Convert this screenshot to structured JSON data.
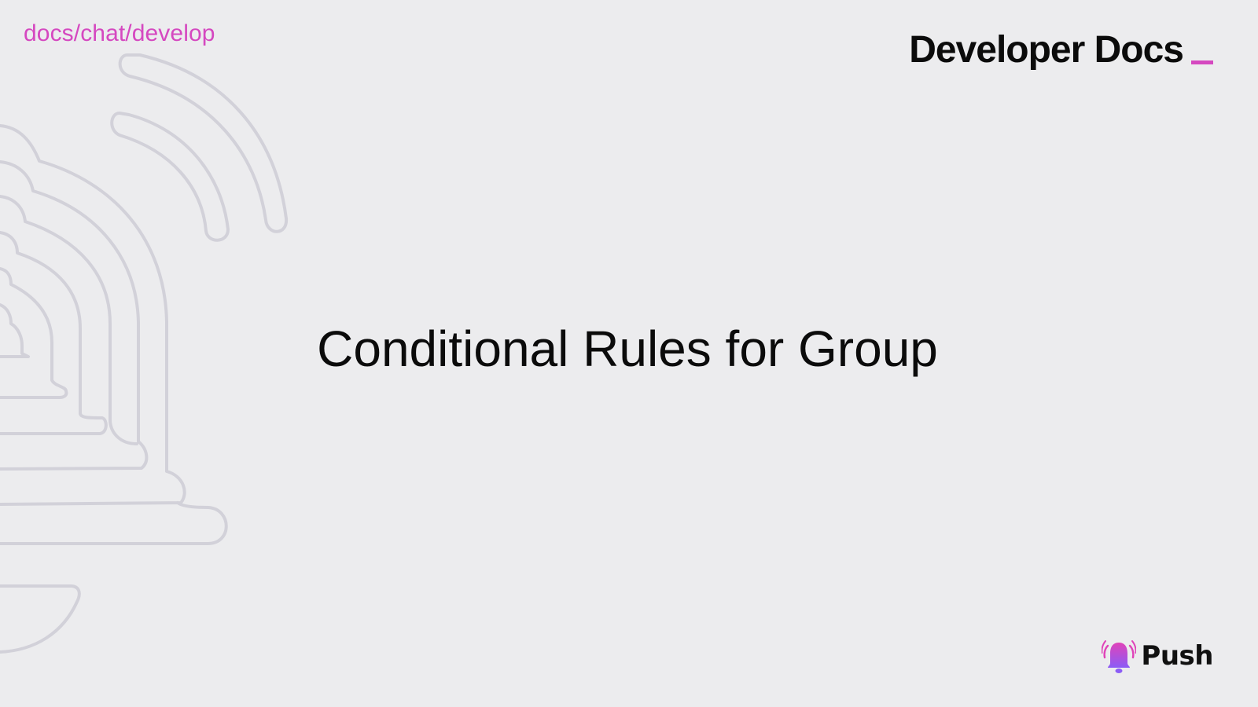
{
  "header": {
    "breadcrumb": "docs/chat/develop",
    "brand_title": "Developer Docs"
  },
  "slide": {
    "title": "Conditional Rules for Group"
  },
  "footer": {
    "logo_text": "Push",
    "logo_icon": "bell-icon"
  },
  "colors": {
    "background": "#ECECEE",
    "accent": "#D548C0",
    "outline": "#D2D1D9",
    "text": "#0B0B0B",
    "logo_gradient_start": "#E043B9",
    "logo_gradient_end": "#8B5CF6"
  }
}
